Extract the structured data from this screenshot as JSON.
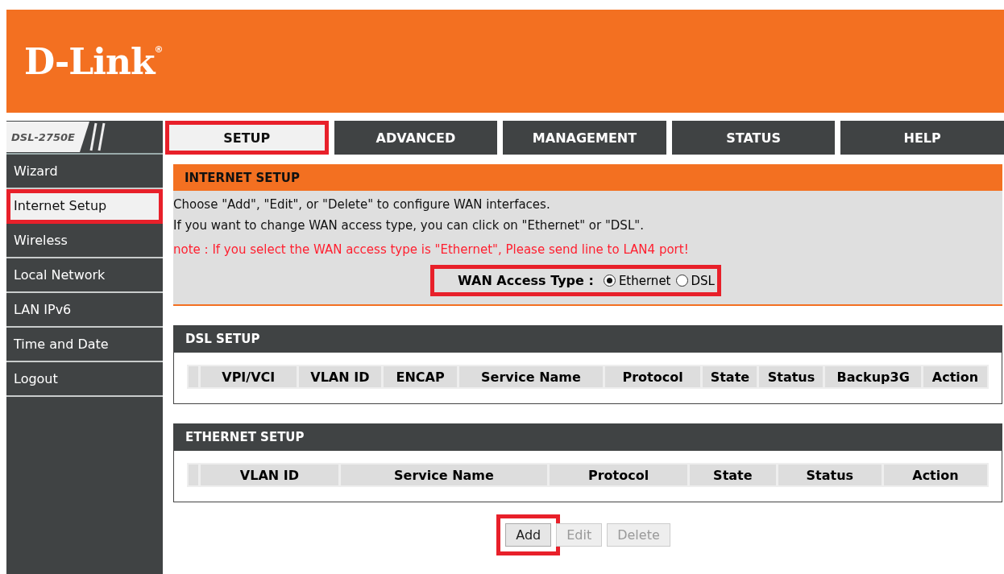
{
  "header": {
    "logo": "D-Link",
    "logo_mark": "®"
  },
  "model": "DSL-2750E",
  "tabs": [
    {
      "label": "SETUP",
      "selected": true,
      "highlighted": true
    },
    {
      "label": "ADVANCED",
      "selected": false,
      "highlighted": false
    },
    {
      "label": "MANAGEMENT",
      "selected": false,
      "highlighted": false
    },
    {
      "label": "STATUS",
      "selected": false,
      "highlighted": false
    },
    {
      "label": "HELP",
      "selected": false,
      "highlighted": false
    }
  ],
  "sidebar": {
    "items": [
      {
        "label": "Wizard",
        "selected": false,
        "highlighted": false
      },
      {
        "label": "Internet Setup",
        "selected": true,
        "highlighted": true
      },
      {
        "label": "Wireless",
        "selected": false,
        "highlighted": false
      },
      {
        "label": "Local Network",
        "selected": false,
        "highlighted": false
      },
      {
        "label": "LAN IPv6",
        "selected": false,
        "highlighted": false
      },
      {
        "label": "Time and Date",
        "selected": false,
        "highlighted": false
      },
      {
        "label": "Logout",
        "selected": false,
        "highlighted": false
      }
    ]
  },
  "internet_setup": {
    "title": "INTERNET SETUP",
    "lines": [
      {
        "text": "Choose \"Add\", \"Edit\", or \"Delete\" to configure WAN interfaces.",
        "kind": "info"
      },
      {
        "text": "If you want to change WAN access type, you can click on \"Ethernet\" or \"DSL\".",
        "kind": "info"
      },
      {
        "text": "note : If you select the WAN access type is \"Ethernet\", Please send line to LAN4 port!",
        "kind": "warning"
      }
    ],
    "wan_access": {
      "label": "WAN Access Type :",
      "highlighted": true,
      "options": [
        {
          "label": "Ethernet",
          "selected": true
        },
        {
          "label": "DSL",
          "selected": false
        }
      ]
    }
  },
  "tables": [
    {
      "title": "DSL SETUP",
      "columns": [
        "VPI/VCI",
        "VLAN ID",
        "ENCAP",
        "Service Name",
        "Protocol",
        "State",
        "Status",
        "Backup3G",
        "Action"
      ]
    },
    {
      "title": "ETHERNET SETUP",
      "columns": [
        "VLAN ID",
        "Service Name",
        "Protocol",
        "State",
        "Status",
        "Action"
      ]
    }
  ],
  "buttons": [
    {
      "label": "Add",
      "disabled": false,
      "highlighted": true
    },
    {
      "label": "Edit",
      "disabled": true,
      "highlighted": false
    },
    {
      "label": "Delete",
      "disabled": true,
      "highlighted": false
    }
  ]
}
